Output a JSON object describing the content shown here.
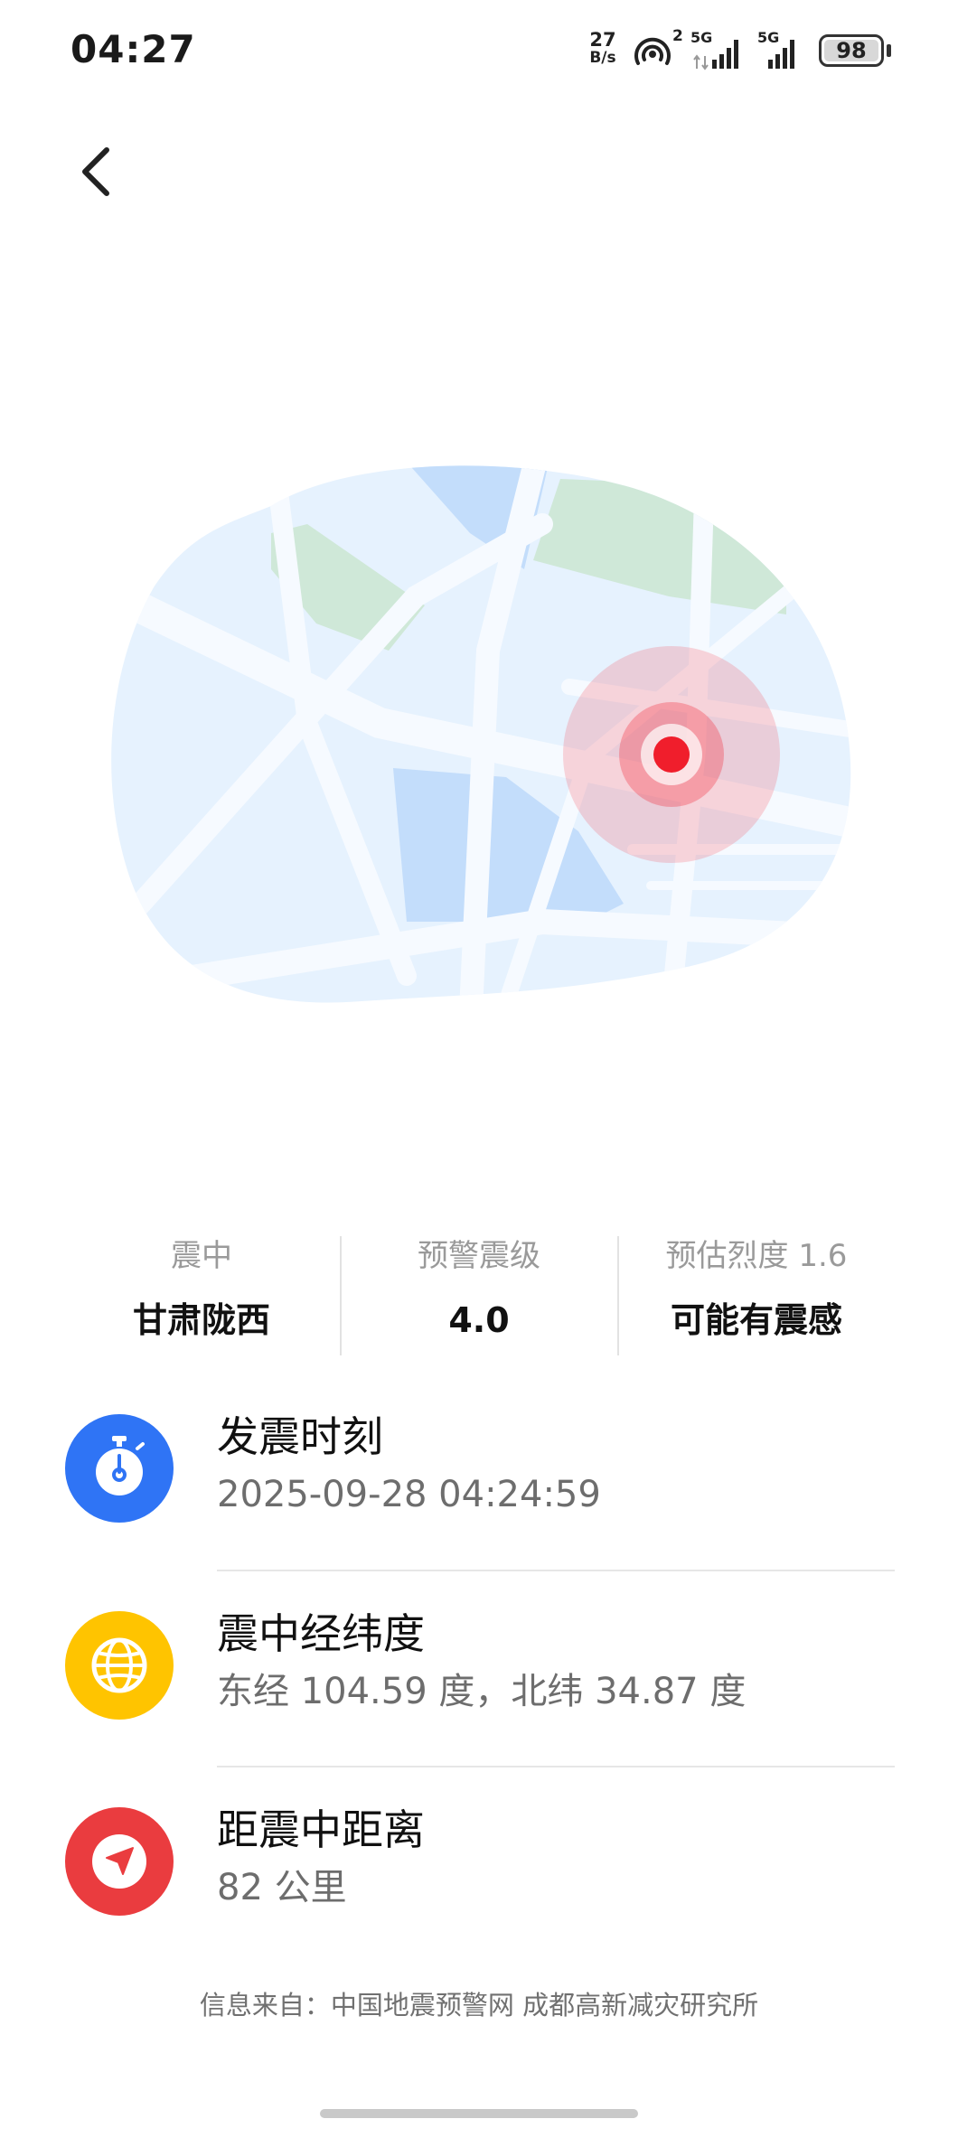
{
  "status_bar": {
    "time": "04:27",
    "net_speed_value": "27",
    "net_speed_unit": "B/s",
    "hotspot_count": "2",
    "signal1_label": "5G",
    "signal2_label": "5G",
    "battery": "98"
  },
  "stats": {
    "epicenter_label": "震中",
    "epicenter_value": "甘肃陇西",
    "magnitude_label": "预警震级",
    "magnitude_value": "4.0",
    "intensity_label": "预估烈度 1.6",
    "intensity_value": "可能有震感"
  },
  "info": {
    "time_title": "发震时刻",
    "time_value": "2025-09-28 04:24:59",
    "coord_title": "震中经纬度",
    "coord_value": "东经 104.59 度，北纬 34.87 度",
    "distance_title": "距震中距离",
    "distance_value": "82 公里"
  },
  "source_text": "信息来自：中国地震预警网 成都高新减灾研究所",
  "icons": {
    "back": "chevron-left-icon",
    "time": "stopwatch-icon",
    "coord": "globe-icon",
    "distance": "navigation-arrow-icon"
  },
  "colors": {
    "time_icon_bg": "#2f74f5",
    "coord_icon_bg": "#ffc400",
    "distance_icon_bg": "#ea3c3f",
    "epicenter_marker": "#f01e2c",
    "map_land": "#e6f2fe",
    "map_water": "#c3ddfb",
    "map_park": "#cfe8d8"
  }
}
